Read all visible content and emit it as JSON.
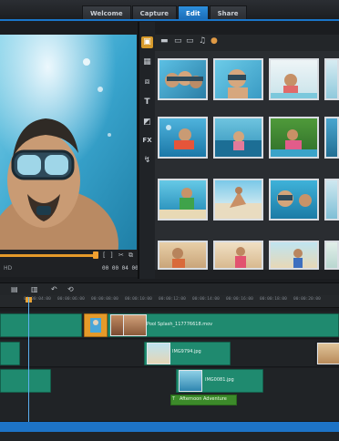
{
  "window": {
    "workspace_tabs": [
      {
        "label": "Welcome",
        "active": false
      },
      {
        "label": "Capture",
        "active": false
      },
      {
        "label": "Edit",
        "active": true
      },
      {
        "label": "Share",
        "active": false
      }
    ],
    "accent_color": "#1a75c8"
  },
  "preview": {
    "quality_label": "HD",
    "timecode": "00 00 04 00",
    "playback_progress": 0.98,
    "icons": [
      "mark-in-icon",
      "mark-out-icon",
      "cut-icon",
      "copy-icon"
    ]
  },
  "library": {
    "tools": [
      "media-icon",
      "instant-project-icon",
      "transition-icon",
      "title-icon",
      "graphic-icon",
      "filter-icon",
      "path-icon"
    ],
    "filter_icons": [
      "folder-icon",
      "video-filter-icon",
      "photo-filter-icon",
      "audio-filter-icon",
      "sort-icon"
    ],
    "thumbnails_count": 16
  },
  "timeline": {
    "tools": [
      "storyboard-icon",
      "timeline-icon",
      "undo-icon",
      "redo-icon"
    ],
    "ruler_labels": [
      "00:00:04:00",
      "00:00:06:00",
      "00:00:08:00",
      "00:00:10:00",
      "00:00:12:00",
      "00:00:14:00",
      "00:00:16:00",
      "00:00:18:00",
      "00:00:20:00",
      "00:00:22:00"
    ],
    "clips": {
      "video_main": "Pool Splash_117776618.mov",
      "overlay1": "IMG9794.jpg",
      "overlay2": "IMG0081.jpg",
      "title": "Afternoon Adventure"
    }
  }
}
